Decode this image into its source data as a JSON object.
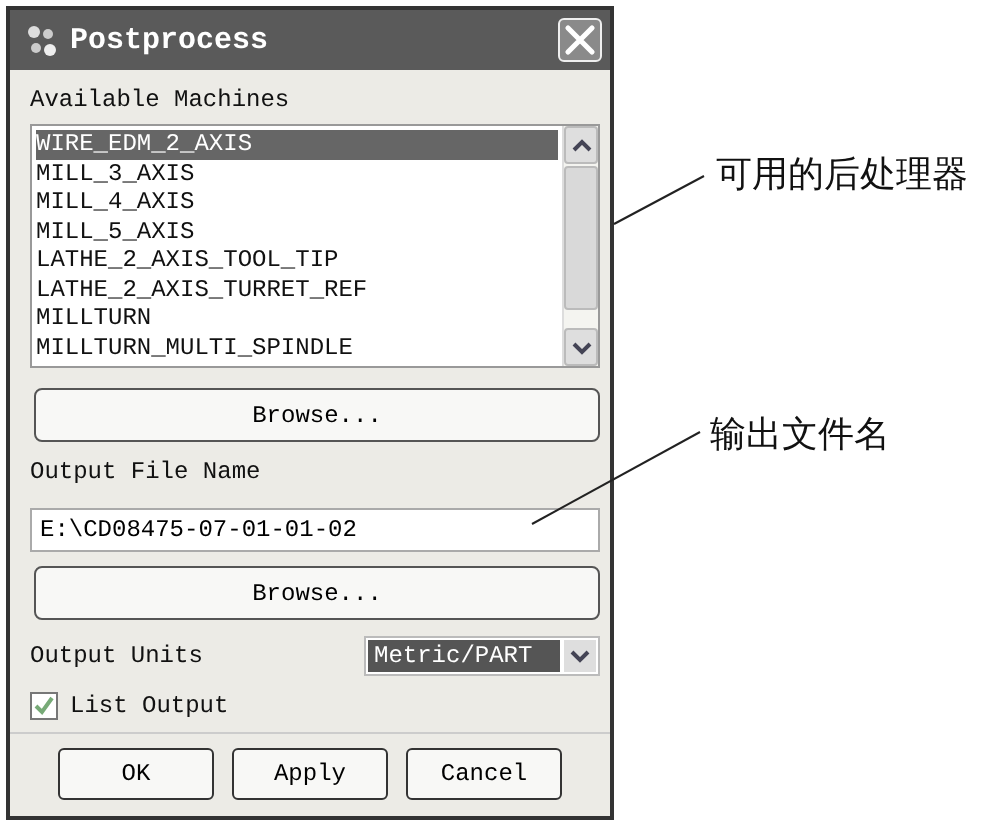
{
  "window": {
    "title": "Postprocess"
  },
  "available_machines": {
    "label": "Available Machines",
    "items": [
      {
        "label": "WIRE_EDM_2_AXIS",
        "selected": true
      },
      {
        "label": "MILL_3_AXIS",
        "selected": false
      },
      {
        "label": "MILL_4_AXIS",
        "selected": false
      },
      {
        "label": "MILL_5_AXIS",
        "selected": false
      },
      {
        "label": "LATHE_2_AXIS_TOOL_TIP",
        "selected": false
      },
      {
        "label": "LATHE_2_AXIS_TURRET_REF",
        "selected": false
      },
      {
        "label": "MILLTURN",
        "selected": false
      },
      {
        "label": "MILLTURN_MULTI_SPINDLE",
        "selected": false
      }
    ]
  },
  "machines_browse_button": "Browse...",
  "output_file": {
    "label": "Output File Name",
    "value": "E:\\CD08475-07-01-01-02"
  },
  "output_browse_button": "Browse...",
  "output_units": {
    "label": "Output Units",
    "value": "Metric/PART"
  },
  "list_output": {
    "label": "List Output",
    "checked": true
  },
  "buttons": [
    "OK",
    "Apply",
    "Cancel"
  ],
  "annotations": [
    {
      "text": "可用的后处理器"
    },
    {
      "text": "输出文件名"
    }
  ]
}
